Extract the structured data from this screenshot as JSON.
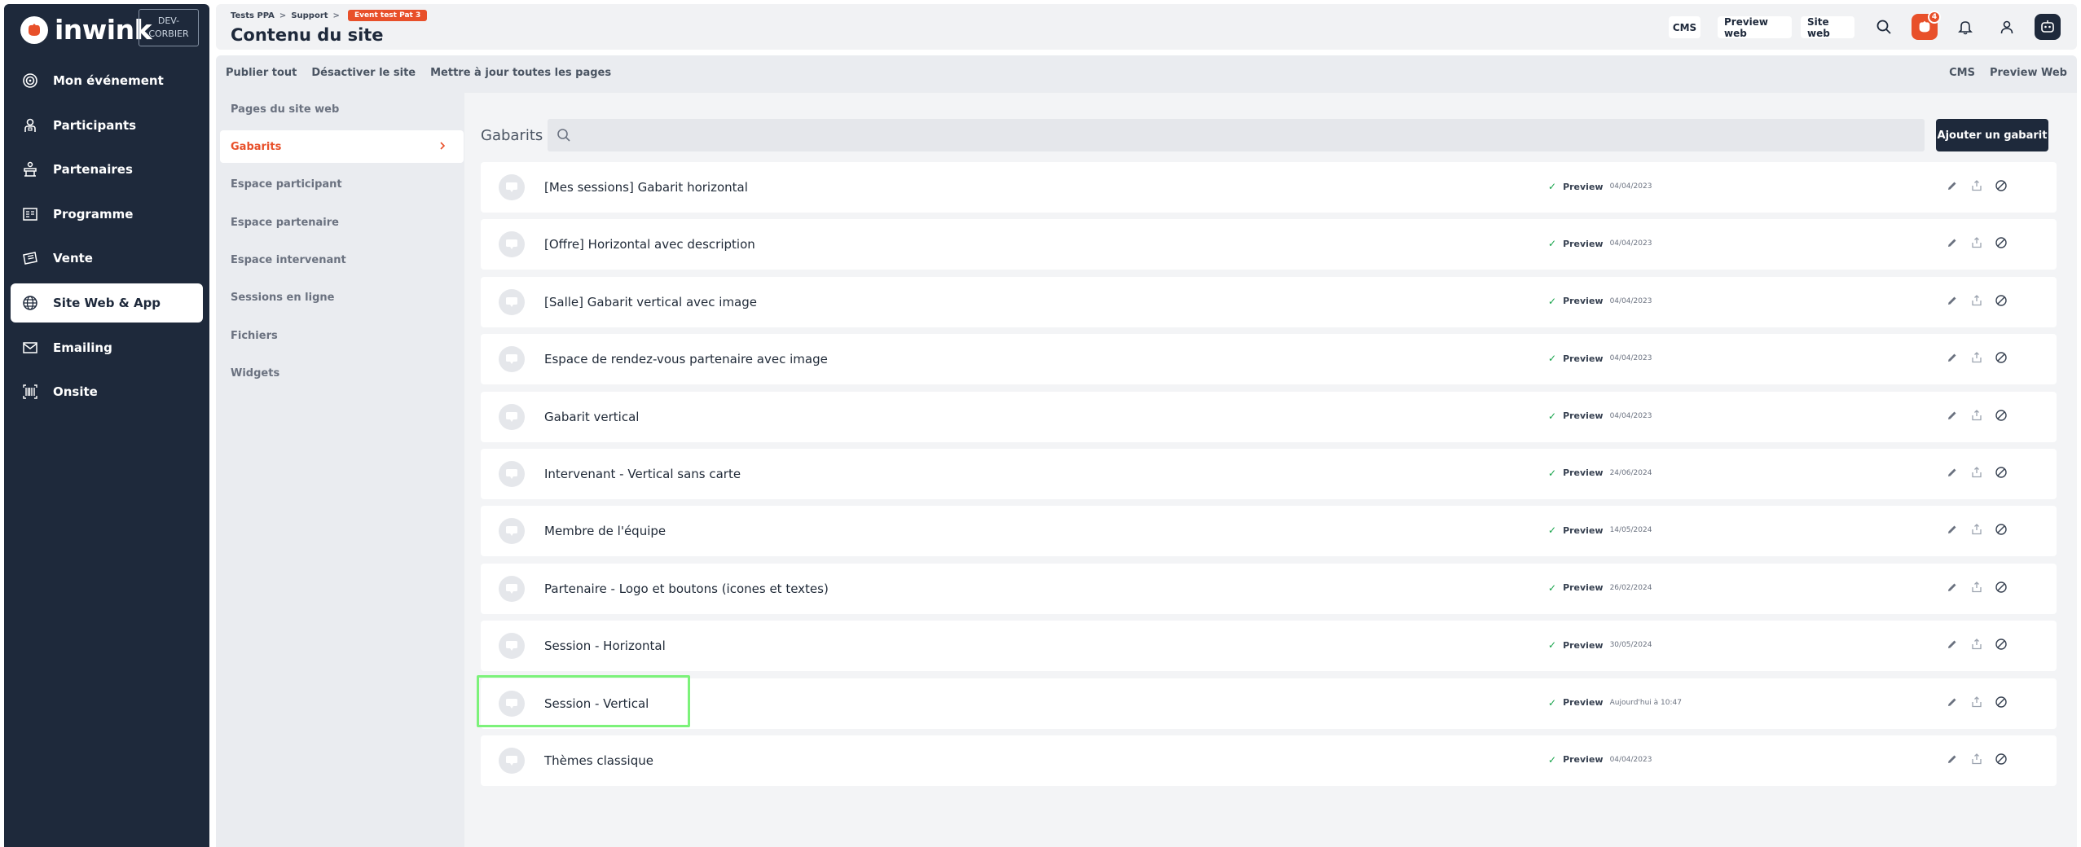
{
  "brand": {
    "name": "inwink",
    "env_line1": "DEV-",
    "env_line2": "CORBIER"
  },
  "sidebar": {
    "items": [
      {
        "label": "Mon événement",
        "icon": "target-icon",
        "active": false
      },
      {
        "label": "Participants",
        "icon": "user-badge-icon",
        "active": false
      },
      {
        "label": "Partenaires",
        "icon": "booth-icon",
        "active": false
      },
      {
        "label": "Programme",
        "icon": "schedule-icon",
        "active": false
      },
      {
        "label": "Vente",
        "icon": "ticket-icon",
        "active": false
      },
      {
        "label": "Site Web & App",
        "icon": "globe-icon",
        "active": true
      },
      {
        "label": "Emailing",
        "icon": "mail-icon",
        "active": false
      },
      {
        "label": "Onsite",
        "icon": "barcode-icon",
        "active": false
      }
    ]
  },
  "header": {
    "breadcrumb": [
      "Tests PPA",
      "Support"
    ],
    "event_badge": "Event test Pat 3",
    "title": "Contenu du site",
    "buttons": {
      "cms": "CMS",
      "preview_web": "Preview web",
      "site_web": "Site web"
    },
    "notification_count": "4"
  },
  "toolbar": {
    "left": [
      "Publier tout",
      "Désactiver le site",
      "Mettre à jour toutes les pages"
    ],
    "right": [
      "CMS",
      "Preview Web"
    ]
  },
  "subnav": {
    "items": [
      {
        "label": "Pages du site web",
        "active": false
      },
      {
        "label": "Gabarits",
        "active": true
      },
      {
        "label": "Espace participant",
        "active": false
      },
      {
        "label": "Espace partenaire",
        "active": false
      },
      {
        "label": "Espace intervenant",
        "active": false
      },
      {
        "label": "Sessions en ligne",
        "active": false
      },
      {
        "label": "Fichiers",
        "active": false
      },
      {
        "label": "Widgets",
        "active": false
      }
    ]
  },
  "content": {
    "title": "Gabarits",
    "search": {
      "value": "",
      "placeholder": ""
    },
    "add_button": "Ajouter un gabarit",
    "rows": [
      {
        "name": "[Mes sessions] Gabarit horizontal",
        "status": "Preview",
        "date": "04/04/2023"
      },
      {
        "name": "[Offre] Horizontal avec description",
        "status": "Preview",
        "date": "04/04/2023"
      },
      {
        "name": "[Salle] Gabarit vertical avec image",
        "status": "Preview",
        "date": "04/04/2023"
      },
      {
        "name": "Espace de rendez-vous partenaire avec image",
        "status": "Preview",
        "date": "04/04/2023"
      },
      {
        "name": "Gabarit vertical",
        "status": "Preview",
        "date": "04/04/2023"
      },
      {
        "name": "Intervenant - Vertical sans carte",
        "status": "Preview",
        "date": "24/06/2024"
      },
      {
        "name": "Membre de l'équipe",
        "status": "Preview",
        "date": "14/05/2024"
      },
      {
        "name": "Partenaire - Logo et boutons (icones et textes)",
        "status": "Preview",
        "date": "26/02/2024"
      },
      {
        "name": "Session - Horizontal",
        "status": "Preview",
        "date": "30/05/2024"
      },
      {
        "name": "Session - Vertical",
        "status": "Preview",
        "date": "Aujourd'hui à 10:47"
      },
      {
        "name": "Thèmes classique",
        "status": "Preview",
        "date": "04/04/2023"
      }
    ]
  },
  "colors": {
    "sidebar_bg": "#1e293b",
    "accent": "#e8502a",
    "success": "#16a34a",
    "highlight": "#7cf27a"
  }
}
